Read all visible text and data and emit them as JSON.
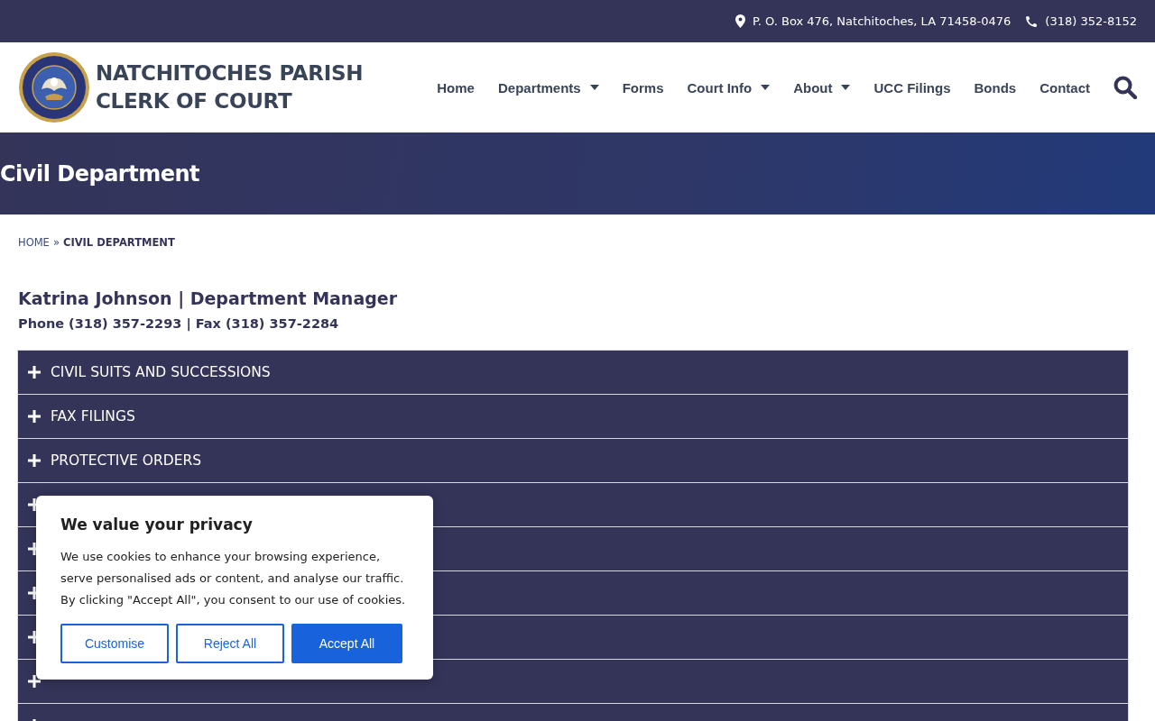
{
  "top_bar": {
    "address": "P. O. Box 476, Natchitoches, LA 71458-0476",
    "phone": "(318) 352-8152"
  },
  "header": {
    "site_title_line1": "NATCHITOCHES PARISH",
    "site_title_line2": "CLERK OF COURT",
    "nav": [
      {
        "label": "Home",
        "has_dropdown": false
      },
      {
        "label": "Departments",
        "has_dropdown": true
      },
      {
        "label": "Forms",
        "has_dropdown": false
      },
      {
        "label": "Court Info",
        "has_dropdown": true
      },
      {
        "label": "About",
        "has_dropdown": true
      },
      {
        "label": "UCC Filings",
        "has_dropdown": false
      },
      {
        "label": "Bonds",
        "has_dropdown": false
      },
      {
        "label": "Contact",
        "has_dropdown": false
      }
    ]
  },
  "hero": {
    "title": "Civil Department"
  },
  "breadcrumb": {
    "home": "HOME",
    "separator": "»",
    "current": "CIVIL DEPARTMENT"
  },
  "manager": {
    "name": "Katrina Johnson | Department Manager",
    "contact": "Phone (318) 357-2293 | Fax (318) 357-2284"
  },
  "accordion": [
    {
      "title": "CIVIL SUITS AND SUCCESSIONS",
      "expanded": false
    },
    {
      "title": "FAX FILINGS",
      "expanded": false
    },
    {
      "title": "PROTECTIVE ORDERS",
      "expanded": false
    },
    {
      "expanded": false
    },
    {
      "expanded": false
    },
    {
      "expanded": false
    },
    {
      "expanded": false
    },
    {
      "expanded": false
    },
    {
      "expanded": false
    }
  ],
  "cookie_banner": {
    "title": "We value your privacy",
    "text": "We use cookies to enhance your browsing experience, serve personalised ads or content, and analyse our traffic. By clicking \"Accept All\", you consent to our use of cookies.",
    "buttons": [
      {
        "label": "Customise",
        "kind": "outline"
      },
      {
        "label": "Reject All",
        "kind": "outline"
      },
      {
        "label": "Accept All",
        "kind": "primary"
      }
    ]
  }
}
